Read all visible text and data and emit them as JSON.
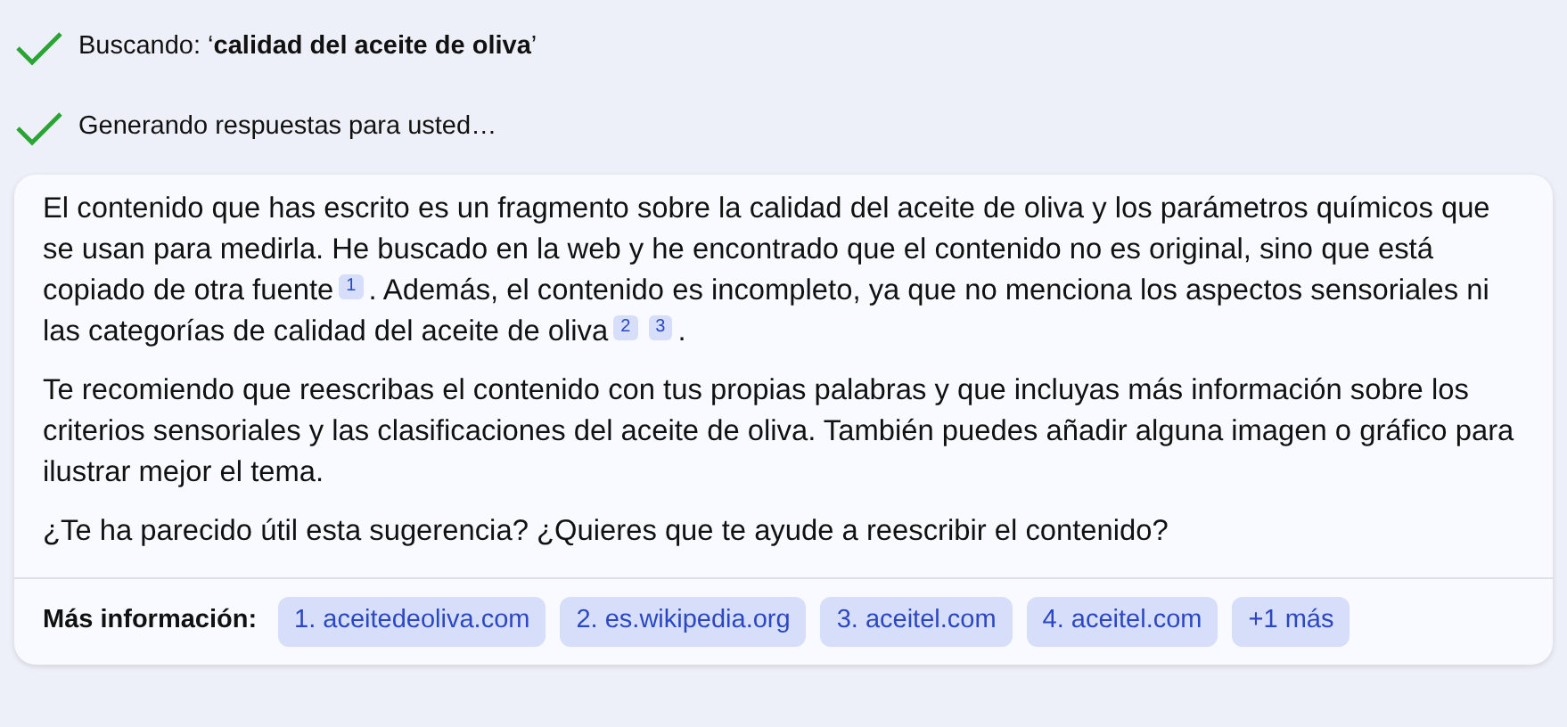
{
  "steps": [
    {
      "text": "Buscando: ‘**calidad del aceite de oliva**’",
      "done": true
    },
    {
      "text": "Generando respuestas para usted…",
      "done": true
    }
  ],
  "answer": {
    "paragraphs": [
      [
        {
          "kind": "text",
          "text": "El contenido que has escrito es un fragmento sobre la calidad del aceite de oliva y los parámetros químicos que se usan para medirla. He buscado en la web y he encontrado que el contenido no es original, sino que está copiado de otra fuente"
        },
        {
          "kind": "cite",
          "text": "1"
        },
        {
          "kind": "text",
          "text": ". Además, el contenido es incompleto, ya que no menciona los aspectos sensoriales ni las categorías de calidad del aceite de oliva"
        },
        {
          "kind": "cite",
          "text": "2"
        },
        {
          "kind": "cite",
          "text": "3"
        },
        {
          "kind": "text",
          "text": "."
        }
      ],
      [
        {
          "kind": "text",
          "text": "Te recomiendo que reescribas el contenido con tus propias palabras y que incluyas más información sobre los criterios sensoriales y las clasificaciones del aceite de oliva. También puedes añadir alguna imagen o gráfico para ilustrar mejor el tema."
        }
      ],
      [
        {
          "kind": "text",
          "text": "¿Te ha parecido útil esta sugerencia? ¿Quieres que te ayude a reescribir el contenido?"
        }
      ]
    ],
    "sources_label": "Más información:",
    "sources": [
      "1. aceitedeoliva.com",
      "2. es.wikipedia.org",
      "3. aceitel.com",
      "4. aceitel.com",
      "+1 más"
    ]
  }
}
